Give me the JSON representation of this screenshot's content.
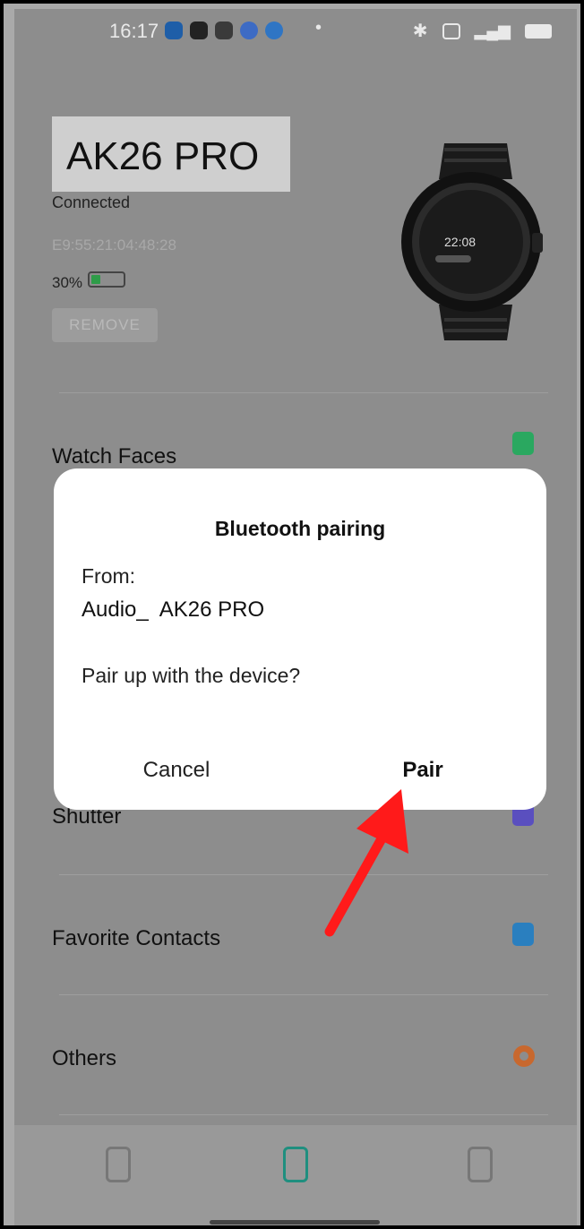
{
  "status_bar": {
    "time": "16:17",
    "app_icon_colors": [
      "#1e78e6",
      "#222222",
      "#e8e8e8",
      "#3d7ef0",
      "#2f8fe8"
    ],
    "dot": "•"
  },
  "device": {
    "name": "AK26 PRO",
    "status": "Connected",
    "mac": "E9:55:21:04:48:28",
    "battery_text": "30%",
    "battery_level": 0.3,
    "remove_label": "REMOVE",
    "watch_time": "22:08"
  },
  "menu": {
    "items": [
      {
        "label": "Watch Faces",
        "icon": "watch-faces-icon",
        "color": "#2fb56a"
      },
      {
        "label": "Shutter",
        "icon": "camera-icon",
        "color": "#5a4fbf"
      },
      {
        "label": "Favorite Contacts",
        "icon": "contacts-icon",
        "color": "#2a7fbf"
      },
      {
        "label": "Others",
        "icon": "gear-icon",
        "color": "#d46a2a"
      }
    ]
  },
  "tabs": [
    {
      "icon": "device-tab-icon"
    },
    {
      "icon": "watch-tab-icon",
      "active": true,
      "color": "#1f8f7f"
    },
    {
      "icon": "profile-tab-icon"
    }
  ],
  "dialog": {
    "title": "Bluetooth pairing",
    "from_label": "From:",
    "device_name": "Audio_  AK26 PRO",
    "question": "Pair up with the device?",
    "cancel_label": "Cancel",
    "pair_label": "Pair"
  },
  "annotation": {
    "arrow_color": "#ff1a1a"
  }
}
